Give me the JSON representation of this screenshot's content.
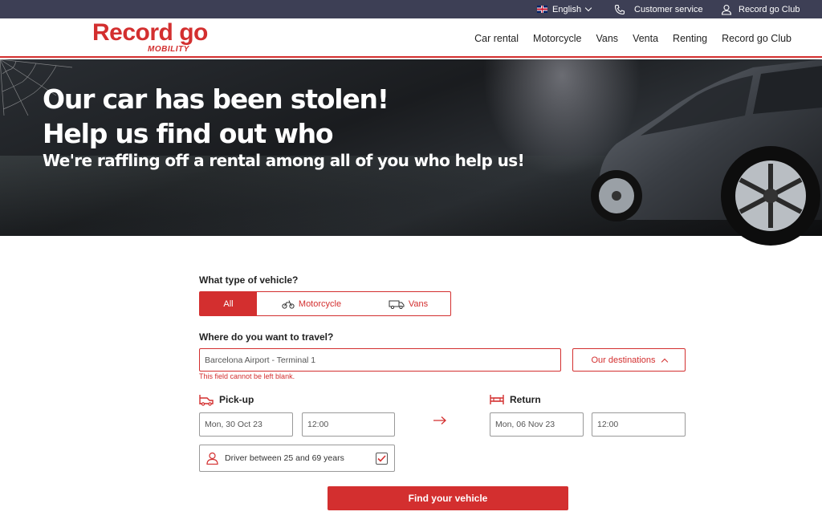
{
  "topbar": {
    "language": "English",
    "customer_service": "Customer service",
    "club": "Record go Club"
  },
  "logo": {
    "main": "Record go",
    "sub": "MOBILITY"
  },
  "nav": {
    "items": [
      "Car rental",
      "Motorcycle",
      "Vans",
      "Venta",
      "Renting",
      "Record go Club"
    ]
  },
  "hero": {
    "title_line1": "Our car has been stolen!",
    "title_line2": "Help us find out who",
    "subtitle": "We're raffling off a rental among all of you who help us!"
  },
  "form": {
    "vehicle_question": "What type of vehicle?",
    "vehicle_types": [
      "All",
      "Motorcycle",
      "Vans"
    ],
    "selected_vehicle": "All",
    "travel_question": "Where do you want to travel?",
    "destination_value": "Barcelona Airport - Terminal 1",
    "destination_error": "This field cannot be left blank.",
    "destinations_button": "Our destinations",
    "pickup_label": "Pick-up",
    "pickup_date": "Mon, 30 Oct 23",
    "pickup_time": "12:00",
    "return_label": "Return",
    "return_date": "Mon, 06 Nov 23",
    "return_time": "12:00",
    "driver_age": "Driver between 25 and 69 years",
    "driver_age_checked": true,
    "submit": "Find your vehicle"
  },
  "colors": {
    "brand": "#d32f2f",
    "topbar": "#3d3f55"
  }
}
